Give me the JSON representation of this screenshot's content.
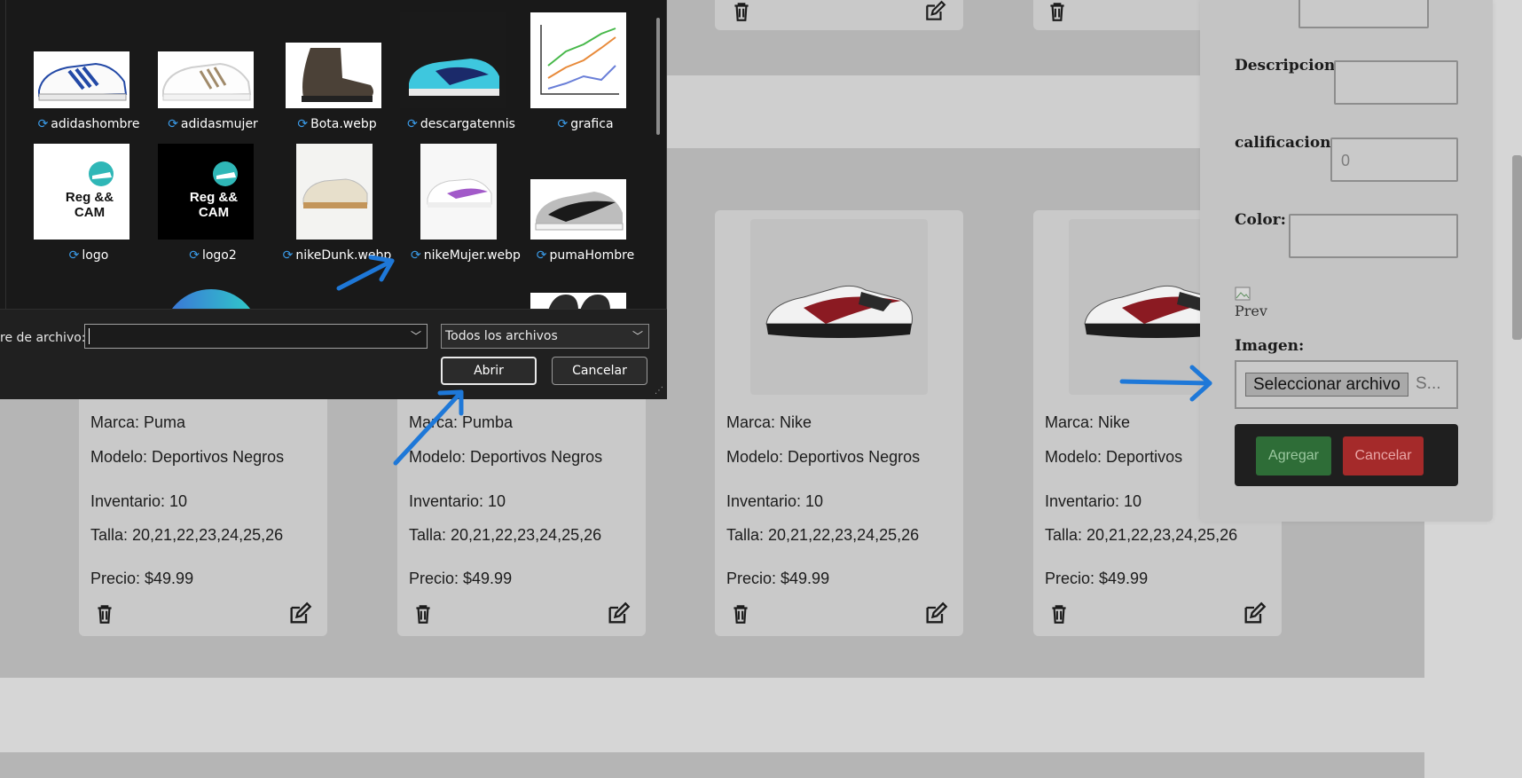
{
  "products": [
    {
      "brand_label": "Marca: Puma",
      "model_label": "Modelo: Deportivos Negros",
      "inventory_label": "Inventario: 10",
      "sizes_label": "Talla: 20,21,22,23,24,25,26",
      "price_label": "Precio: $49.99"
    },
    {
      "brand_label": "Marca: Pumba",
      "model_label": "Modelo: Deportivos Negros",
      "inventory_label": "Inventario: 10",
      "sizes_label": "Talla: 20,21,22,23,24,25,26",
      "price_label": "Precio: $49.99"
    },
    {
      "brand_label": "Marca: Nike",
      "model_label": "Modelo: Deportivos Negros",
      "inventory_label": "Inventario: 10",
      "sizes_label": "Talla: 20,21,22,23,24,25,26",
      "price_label": "Precio: $49.99"
    },
    {
      "brand_label": "Marca: Nike",
      "model_label": "Modelo: Deportivos",
      "inventory_label": "Inventario: 10",
      "sizes_label": "Talla: 20,21,22,23,24,25,26",
      "price_label": "Precio: $49.99"
    }
  ],
  "form": {
    "descripcion_label": "Descripcion:",
    "calificacion_label": "calificacion:",
    "calificacion_value": "0",
    "color_label": "Color:",
    "preview_alt": "Prev",
    "imagen_label": "Imagen:",
    "file_button": "Seleccionar archivo",
    "file_status": "S...",
    "add_button": "Agregar",
    "cancel_button": "Cancelar"
  },
  "dialog": {
    "files": [
      {
        "name": "adidashombre"
      },
      {
        "name": "adidasmujer"
      },
      {
        "name": "Bota.webp"
      },
      {
        "name": "descargatennis"
      },
      {
        "name": "grafica"
      },
      {
        "name": "logo",
        "logo_text": "Reg &&\nCAM"
      },
      {
        "name": "logo2",
        "logo_text": "Reg &&\nCAM"
      },
      {
        "name": "nikeDunk.webp"
      },
      {
        "name": "nikeMujer.webp"
      },
      {
        "name": "pumaHombre"
      }
    ],
    "filename_label": "re de archivo:",
    "filename_value": "",
    "filter_value": "Todos los archivos",
    "open_button": "Abrir",
    "cancel_button": "Cancelar"
  },
  "colors": {
    "annotation_arrow": "#1e78d8",
    "add_green": "#2e6d37",
    "cancel_red": "#a52a2a",
    "sync_blue": "#3a9be8"
  }
}
